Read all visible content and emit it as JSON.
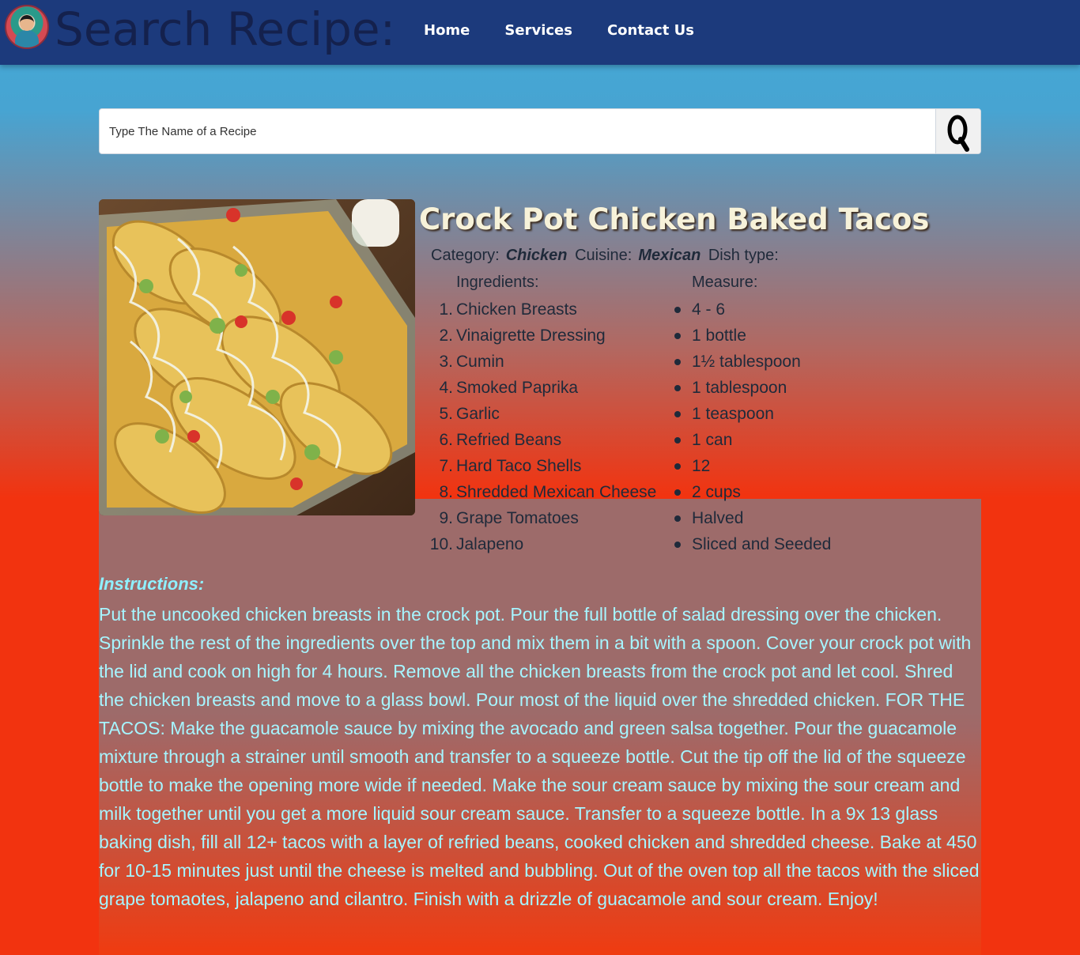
{
  "header": {
    "app_title": "Search Recipe:",
    "nav": [
      "Home",
      "Services",
      "Contact Us"
    ]
  },
  "search": {
    "placeholder": "Type The Name of a Recipe"
  },
  "recipe": {
    "title": "Crock Pot Chicken Baked Tacos",
    "category_label": "Category:",
    "category": "Chicken",
    "cuisine_label": "Cuisine:",
    "cuisine": "Mexican",
    "dish_type_label": "Dish type:",
    "ingredients_heading": "Ingredients:",
    "measure_heading": "Measure:",
    "ingredients": [
      "Chicken Breasts",
      "Vinaigrette Dressing",
      "Cumin",
      "Smoked Paprika",
      "Garlic",
      "Refried Beans",
      "Hard Taco Shells",
      "Shredded Mexican Cheese",
      "Grape Tomatoes",
      "Jalapeno"
    ],
    "measures": [
      "4 - 6",
      "1 bottle",
      "1½ tablespoon",
      "1 tablespoon",
      "1 teaspoon",
      "1 can",
      "12",
      "2 cups",
      "Halved",
      "Sliced and Seeded"
    ],
    "instructions_heading": "Instructions:",
    "instructions": "Put the uncooked chicken breasts in the crock pot. Pour the full bottle of salad dressing over the chicken. Sprinkle the rest of the ingredients over the top and mix them in a bit with a spoon. Cover your crock pot with the lid and cook on high for 4 hours. Remove all the chicken breasts from the crock pot and let cool. Shred the chicken breasts and move to a glass bowl. Pour most of the liquid over the shredded chicken. FOR THE TACOS: Make the guacamole sauce by mixing the avocado and green salsa together. Pour the guacamole mixture through a strainer until smooth and transfer to a squeeze bottle. Cut the tip off the lid of the squeeze bottle to make the opening more wide if needed. Make the sour cream sauce by mixing the sour cream and milk together until you get a more liquid sour cream sauce. Transfer to a squeeze bottle. In a 9x 13 glass baking dish, fill all 12+ tacos with a layer of refried beans, cooked chicken and shredded cheese. Bake at 450 for 10-15 minutes just until the cheese is melted and bubbling. Out of the oven top all the tacos with the sliced grape tomaotes, jalapeno and cilantro. Finish with a drizzle of guacamole and sour cream. Enjoy!"
  },
  "colors": {
    "header_bg": "#1c3a7c",
    "title_color": "#f7f2d9",
    "instructions_color": "#a6f5ff"
  }
}
